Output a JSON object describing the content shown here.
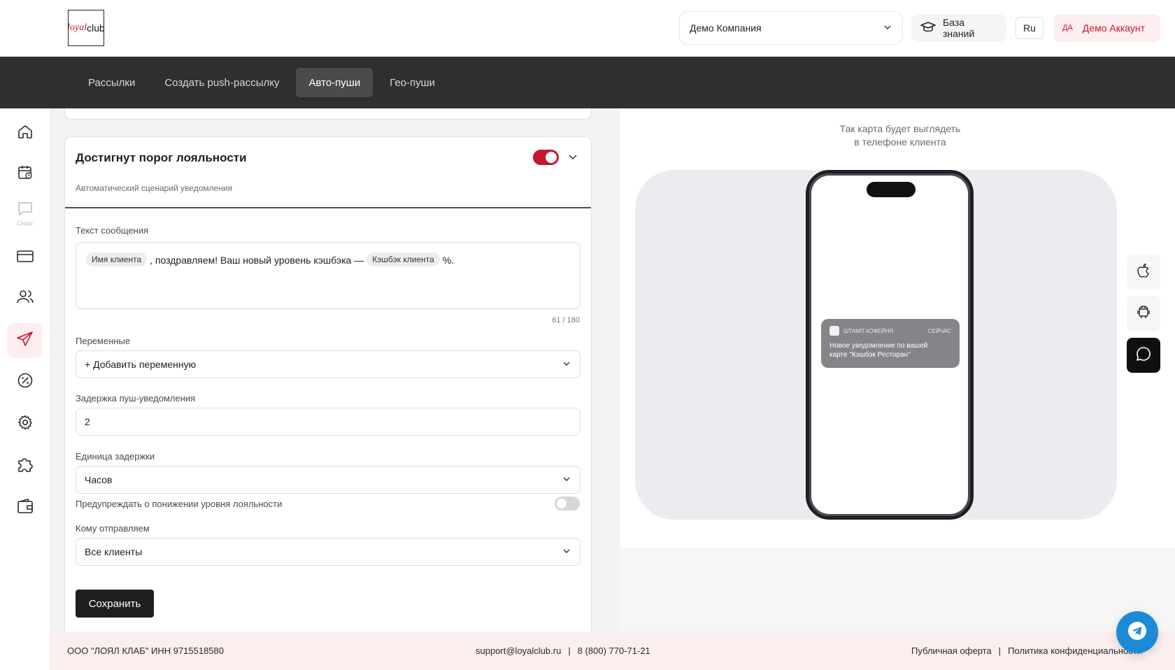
{
  "header": {
    "logo": {
      "loyal": "loyal",
      "club": "club"
    },
    "company_select": {
      "value": "Демо Компания"
    },
    "knowledge_base": "База знаний",
    "language": "Ru",
    "account": {
      "initials": "ДА",
      "name": "Демо Аккаунт"
    }
  },
  "tabs": [
    {
      "label": "Рассылки",
      "active": false
    },
    {
      "label": "Создать push-рассылку",
      "active": false
    },
    {
      "label": "Авто-пуши",
      "active": true
    },
    {
      "label": "Гео-пуши",
      "active": false
    }
  ],
  "sidebar": {
    "items": [
      {
        "icon": "home-icon"
      },
      {
        "icon": "calendar-icon"
      },
      {
        "icon": "chat-icon",
        "badge": "Скоро"
      },
      {
        "icon": "card-icon"
      },
      {
        "icon": "users-icon"
      },
      {
        "icon": "send-icon",
        "active": true
      },
      {
        "icon": "percent-icon"
      },
      {
        "icon": "gear-icon"
      },
      {
        "icon": "puzzle-icon"
      },
      {
        "icon": "wallet-icon"
      }
    ]
  },
  "form": {
    "title": "Достигнут порог лояльности",
    "subtitle": "Автоматический сценарий уведомления",
    "enabled": true,
    "message_label": "Текст сообщения",
    "message": {
      "chip1": "Имя клиента",
      "text1": ", поздравляем! Ваш новый уровень кэшбэка —",
      "chip2": "Кэшбэк клиента",
      "text2": "%."
    },
    "counter": "61 / 180",
    "variables_label": "Переменные",
    "variables_value": "+ Добавить переменную",
    "delay_label": "Задержка пуш-уведомления",
    "delay_value": "2",
    "unit_label": "Единица задержки",
    "unit_value": "Часов",
    "warn_label": "Предупреждать о понижении уровня лояльности",
    "warn_enabled": false,
    "recipients_label": "Кому отправляем",
    "recipients_value": "Все клиенты",
    "save_label": "Сохранить"
  },
  "preview": {
    "title_line1": "Так карта будет выглядеть",
    "title_line2": "в телефоне клиента",
    "notification": {
      "app": "ШТАМП КОФЕЙНЯ",
      "time": "СЕЙЧАС",
      "line1": "Новое уведомление по вашей",
      "line2": "карте \"Кэшбэк Ресторан\""
    },
    "devices": [
      {
        "icon": "apple-icon"
      },
      {
        "icon": "android-icon"
      },
      {
        "icon": "message-icon",
        "active": true
      }
    ]
  },
  "footer": {
    "company": "ООО \"ЛОЯЛ КЛАБ\" ИНН 9715518580",
    "email": "support@loyalclub.ru",
    "phone": "8 (800) 770-71-21",
    "offer": "Публичная оферта",
    "privacy": "Политика конфиденциальности"
  },
  "colors": {
    "accent": "#c5172e",
    "tabbar": "#2f2f30",
    "footer": "#fbeeef",
    "telegram": "#1c8bd7"
  }
}
